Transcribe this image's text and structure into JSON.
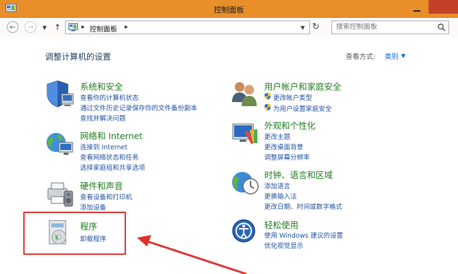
{
  "window": {
    "title": "控制面板"
  },
  "address": {
    "crumb": "控制面板"
  },
  "search": {
    "placeholder": "搜索控制面板"
  },
  "content": {
    "page_title": "调整计算机的设置",
    "view_by_label": "查看方式:",
    "view_by_value": "类别"
  },
  "categories": [
    {
      "title": "系统和安全",
      "links": [
        "查看你的计算机状态",
        "通过文件历史记录保存你的文件备份副本",
        "查找并解决问题"
      ]
    },
    {
      "title": "网络和 Internet",
      "links": [
        "连接到 Internet",
        "查看网络状态和任务",
        "选择家庭组和共享选项"
      ]
    },
    {
      "title": "硬件和声音",
      "links": [
        "查看设备和打印机",
        "添加设备"
      ]
    },
    {
      "title": "程序",
      "links": [
        "卸载程序"
      ]
    },
    {
      "title": "用户帐户和家庭安全",
      "links": [
        "更改帐户类型",
        "为用户设置家庭安全"
      ]
    },
    {
      "title": "外观和个性化",
      "links": [
        "更改主题",
        "更改桌面背景",
        "调整屏幕分辨率"
      ]
    },
    {
      "title": "时钟、语言和区域",
      "links": [
        "添加语言",
        "更换输入法",
        "更改日期、时间或数字格式"
      ]
    },
    {
      "title": "轻松使用",
      "links": [
        "使用 Windows 建议的设置",
        "优化视觉显示"
      ]
    }
  ],
  "colors": {
    "titlebar": "#e88f2a",
    "close": "#c4402b",
    "category_title": "#1f7a1f",
    "link": "#1f4fa0",
    "highlight": "#e0302a"
  }
}
